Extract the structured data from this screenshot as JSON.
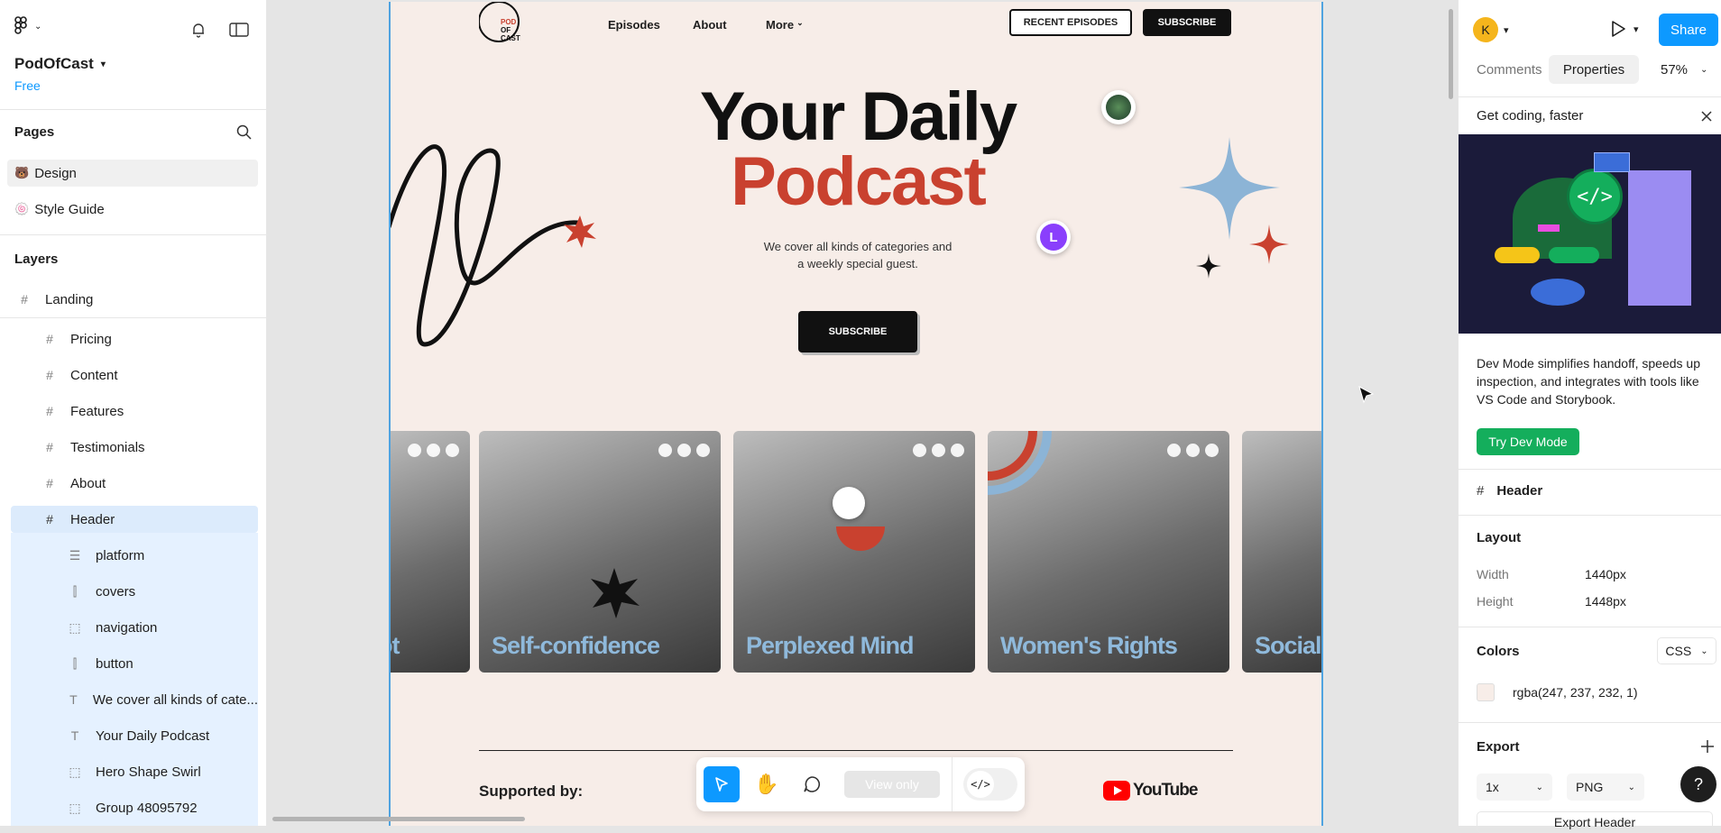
{
  "app": {
    "file_name": "PodOfCast",
    "plan": "Free"
  },
  "left_panel": {
    "pages_title": "Pages",
    "pages": [
      {
        "label": "Design",
        "emoji": "🐻"
      },
      {
        "label": "Style Guide",
        "emoji": "🍥"
      }
    ],
    "layers_title": "Layers",
    "root_frame": "Landing",
    "layers": [
      {
        "label": "Pricing",
        "icon": "frame-icon"
      },
      {
        "label": "Content",
        "icon": "frame-icon"
      },
      {
        "label": "Features",
        "icon": "frame-icon"
      },
      {
        "label": "Testimonials",
        "icon": "frame-icon"
      },
      {
        "label": "About",
        "icon": "frame-icon"
      },
      {
        "label": "Header",
        "icon": "frame-icon"
      }
    ],
    "header_children": [
      {
        "label": "platform",
        "icon": "autolayout-vertical-icon"
      },
      {
        "label": "covers",
        "icon": "autolayout-horizontal-icon"
      },
      {
        "label": "navigation",
        "icon": "group-icon"
      },
      {
        "label": "button",
        "icon": "autolayout-horizontal-icon"
      },
      {
        "label": "We cover all kinds of cate...",
        "icon": "text-icon"
      },
      {
        "label": "Your Daily Podcast",
        "icon": "text-icon"
      },
      {
        "label": "Hero Shape Swirl",
        "icon": "group-icon"
      },
      {
        "label": "Group 48095792",
        "icon": "group-icon"
      }
    ]
  },
  "site": {
    "logo_lines": [
      "POD",
      "OF",
      "CAST"
    ],
    "nav": [
      "Episodes",
      "About",
      "More"
    ],
    "nav_recent": "RECENT EPISODES",
    "nav_subscribe": "SUBSCRIBE",
    "hero_line1": "Your Daily",
    "hero_line2": "Podcast",
    "hero_sub_line1": "We cover all kinds of categories and",
    "hero_sub_line2": "a weekly special guest.",
    "hero_button": "SUBSCRIBE",
    "avatar_letter": "L",
    "cards": [
      "ot",
      "Self-confidence",
      "Perplexed Mind",
      "Women's Rights",
      "Social"
    ],
    "supported_by": "Supported by:",
    "youtube": "YouTube"
  },
  "toolbar": {
    "view_only": "View only"
  },
  "right_panel": {
    "user_initial": "K",
    "share": "Share",
    "tab_comments": "Comments",
    "tab_properties": "Properties",
    "zoom": "57%",
    "promo_title": "Get coding, faster",
    "promo_body": "Dev Mode simplifies handoff, speeds up inspection, and integrates with tools like VS Code and Storybook.",
    "promo_button": "Try Dev Mode",
    "selection_name": "Header",
    "layout_title": "Layout",
    "width_label": "Width",
    "width_value": "1440px",
    "height_label": "Height",
    "height_value": "1448px",
    "colors_title": "Colors",
    "colors_format": "CSS",
    "color_value": "rgba(247, 237, 232, 1)",
    "color_swatch": "#f7ede8",
    "export_title": "Export",
    "export_scale": "1x",
    "export_format": "PNG",
    "export_button": "Export Header",
    "help": "?"
  },
  "colors": {
    "accent_blue": "#0d99ff",
    "podcast_red": "#c9412f",
    "dev_green": "#14ae5c"
  }
}
